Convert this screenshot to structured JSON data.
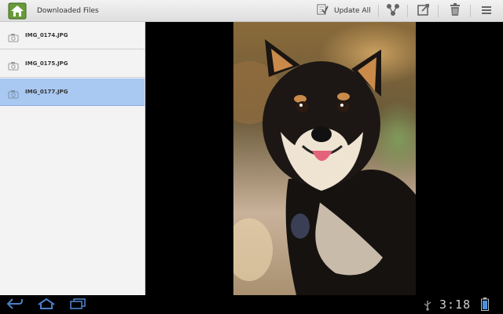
{
  "actionbar": {
    "title": "Downloaded Files",
    "app_icon": "app-logo-icon",
    "update_all_label": "Update All",
    "actions": [
      "update-all-icon",
      "share-icon",
      "export-icon",
      "delete-icon",
      "overflow-menu-icon"
    ]
  },
  "files": [
    {
      "name": "IMG_0174.JPG",
      "selected": false
    },
    {
      "name": "IMG_0175.JPG",
      "selected": false
    },
    {
      "name": "IMG_0177.JPG",
      "selected": true
    }
  ],
  "preview": {
    "subject": "photo-preview"
  },
  "systembar": {
    "time": "3:18",
    "nav": [
      "back-icon",
      "home-icon",
      "recent-apps-icon"
    ],
    "status_icons": [
      "usb-icon",
      "battery-icon"
    ]
  },
  "colors": {
    "selected_row": "#a9c8f2",
    "actionbar_bg": "#e8e8e8",
    "sidebar_bg": "#f3f3f3",
    "nav_icon": "#4a7fc7"
  }
}
